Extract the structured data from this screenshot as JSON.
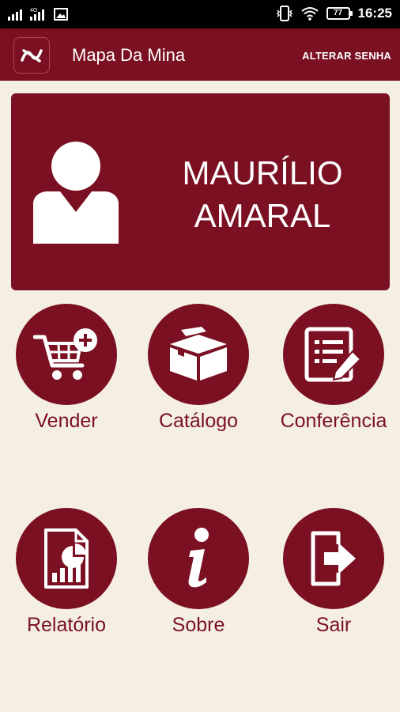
{
  "status_bar": {
    "time": "16:25",
    "battery": "77"
  },
  "app_bar": {
    "title": "Mapa Da Mina",
    "action_label": "ALTERAR SENHA"
  },
  "profile": {
    "name_line1": "MAURÍLIO",
    "name_line2": "AMARAL"
  },
  "menu": {
    "items": [
      {
        "label": "Vender",
        "icon": "cart-add-icon"
      },
      {
        "label": "Catálogo",
        "icon": "boxes-icon"
      },
      {
        "label": "Conferência",
        "icon": "form-edit-icon"
      },
      {
        "label": "Relatório",
        "icon": "report-chart-icon"
      },
      {
        "label": "Sobre",
        "icon": "info-icon"
      },
      {
        "label": "Sair",
        "icon": "exit-icon"
      }
    ]
  },
  "colors": {
    "primary": "#7a1021",
    "background": "#f5efe1",
    "status_bar": "#000000"
  }
}
